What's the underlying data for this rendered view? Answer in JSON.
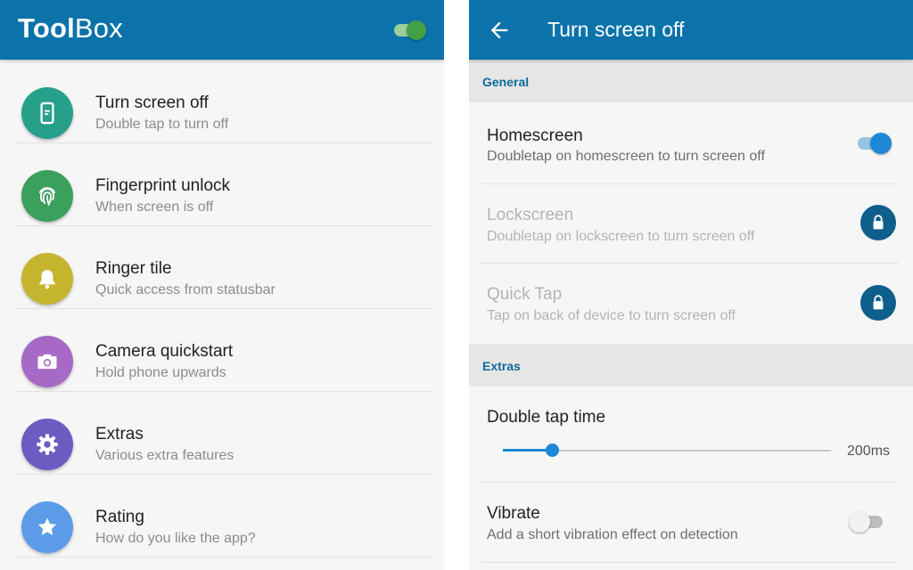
{
  "left_screen": {
    "app_title_bold": "Tool",
    "app_title_light": "Box",
    "master_toggle_on": true,
    "items": [
      {
        "title": "Turn screen off",
        "subtitle": "Double tap to turn off",
        "icon": "phone-screen-icon",
        "color": "#26a08b"
      },
      {
        "title": "Fingerprint unlock",
        "subtitle": "When screen is off",
        "icon": "fingerprint-icon",
        "color": "#3aa05c"
      },
      {
        "title": "Ringer tile",
        "subtitle": "Quick access from statusbar",
        "icon": "bell-icon",
        "color": "#c5b52e"
      },
      {
        "title": "Camera quickstart",
        "subtitle": "Hold phone upwards",
        "icon": "camera-icon",
        "color": "#a66ac6"
      },
      {
        "title": "Extras",
        "subtitle": "Various extra features",
        "icon": "gear-icon",
        "color": "#6a5cc0"
      },
      {
        "title": "Rating",
        "subtitle": "How do you like the app?",
        "icon": "star-icon",
        "color": "#5b9be8"
      }
    ]
  },
  "right_screen": {
    "title": "Turn screen off",
    "sections": {
      "general": "General",
      "extras": "Extras"
    },
    "prefs": {
      "homescreen": {
        "title": "Homescreen",
        "subtitle": "Doubletap on homescreen to turn screen off",
        "enabled": true
      },
      "lockscreen": {
        "title": "Lockscreen",
        "subtitle": "Doubletap on lockscreen to turn screen off",
        "locked": true
      },
      "quick_tap": {
        "title": "Quick Tap",
        "subtitle": "Tap on back of device to turn screen off",
        "locked": true
      },
      "double_tap_time": {
        "title": "Double tap time",
        "value_label": "200ms",
        "slider_fraction": 0.15
      },
      "vibrate": {
        "title": "Vibrate",
        "subtitle": "Add a short vibration effect on detection",
        "enabled": false
      }
    }
  },
  "colors": {
    "app_bar": "#0b73aa",
    "accent": "#1d88d6",
    "section_text": "#0b6a9c",
    "lock_button": "#0e5f8c"
  }
}
